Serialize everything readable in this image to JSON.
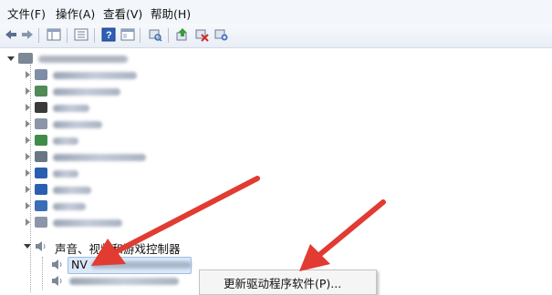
{
  "menubar": {
    "items": [
      "文件(F)",
      "操作(A)",
      "查看(V)",
      "帮助(H)"
    ]
  },
  "toolbar": {
    "buttons": [
      "back-icon",
      "forward-icon",
      "properties-view-icon",
      "list-view-icon",
      "help-icon",
      "console-tree-icon",
      "scan-hardware-icon",
      "update-driver-icon",
      "disable-device-icon",
      "uninstall-device-icon"
    ]
  },
  "tree": {
    "category_label": "声音、视频和游戏控制器",
    "selected_device_prefix": "NV"
  },
  "context_menu": {
    "update_driver": "更新驱动程序软件(P)..."
  },
  "colors": {
    "arrow": "#e13b32",
    "selection": "#dbe8f7",
    "menubar_bg": "#f3f6fb"
  }
}
